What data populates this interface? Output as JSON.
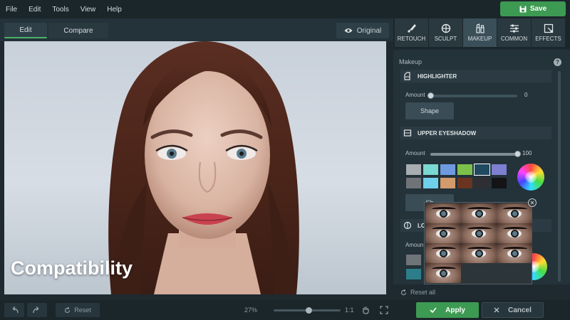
{
  "menu": {
    "items": [
      "File",
      "Edit",
      "Tools",
      "View",
      "Help"
    ],
    "save_label": "Save"
  },
  "toolbar": {
    "edit_tab": "Edit",
    "compare_tab": "Compare",
    "original_label": "Original"
  },
  "overlay_text": "Compatibility",
  "right_tabs": [
    {
      "label": "RETOUCH",
      "icon": "brush-icon"
    },
    {
      "label": "SCULPT",
      "icon": "crosshair-icon"
    },
    {
      "label": "MAKEUP",
      "icon": "lipstick-icon"
    },
    {
      "label": "COMMON",
      "icon": "sliders-icon"
    },
    {
      "label": "EFFECTS",
      "icon": "effects-icon"
    }
  ],
  "active_right_tab": "MAKEUP",
  "panel": {
    "title": "Makeup",
    "help": "?",
    "highlighter": {
      "heading": "HIGHLIGHTER",
      "amount_label": "Amount",
      "amount_value": "0",
      "amount_level": 0,
      "shape_label": "Shape"
    },
    "upper_eyeshadow": {
      "heading": "UPPER EYESHADOW",
      "amount_label": "Amount",
      "amount_value": "100",
      "amount_level": 1.0,
      "swatches_row1": [
        "#a7adb1",
        "#7ad9d2",
        "#6e9be0",
        "#7cc24a",
        "#1f4a60",
        "#7e7fd0"
      ],
      "swatches_row2": [
        "#6f7478",
        "#6ed0ea",
        "#d39a6c",
        "#6a3420",
        "#2f2f33",
        "#141416"
      ],
      "selected_swatch": 4,
      "shape_label_partial": "Sh"
    },
    "lower": {
      "heading_partial": "LO",
      "amount_label_partial": "Amoun",
      "swatches": [
        "#6f7478",
        "#2c7f8a"
      ]
    },
    "reset_all": "Reset all"
  },
  "popup": {
    "close": "✕",
    "eye_count": 10
  },
  "bottom": {
    "reset_label": "Reset",
    "zoom_percent": "27%",
    "zoom_level": 0.52,
    "zoom_1to1": "1:1",
    "apply_label": "Apply",
    "cancel_label": "Cancel"
  },
  "colors": {
    "accent_green": "#3d9a52",
    "panel_bg": "#24323a",
    "selected_swatch_border": "#ffffff"
  }
}
